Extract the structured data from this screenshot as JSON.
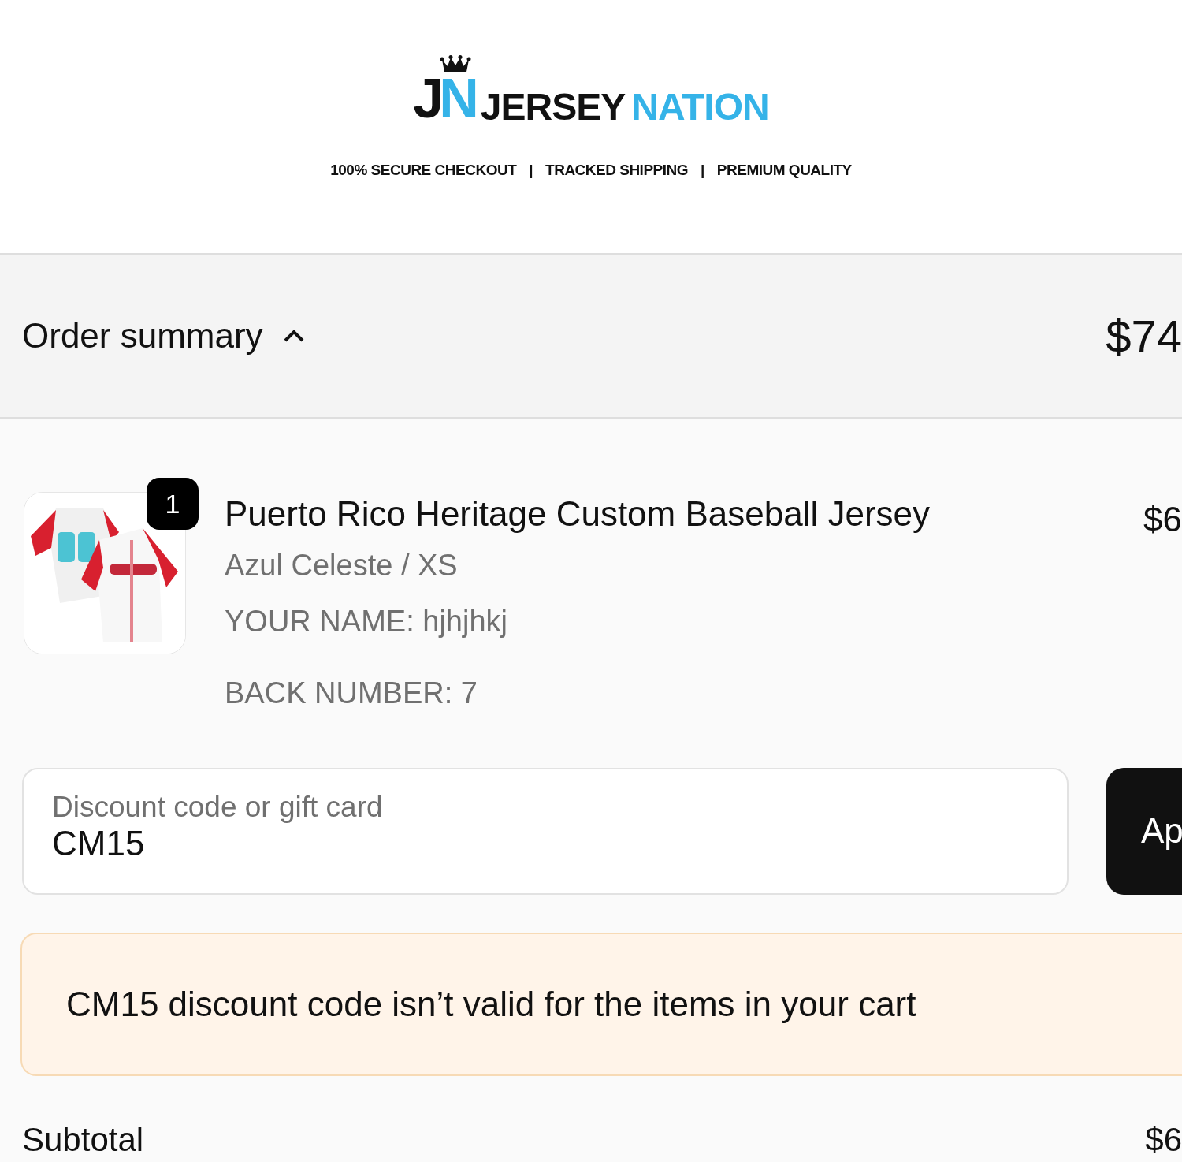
{
  "logo": {
    "monogram": [
      {
        "letter": "J",
        "color": "#111111"
      },
      {
        "letter": "N",
        "color": "#35b3e8"
      }
    ],
    "words": [
      {
        "text": "JERSEY",
        "color": "#111111"
      },
      {
        "text": "NATION",
        "color": "#35b3e8"
      }
    ]
  },
  "taglines": [
    "100% SECURE CHECKOUT",
    "TRACKED SHIPPING",
    "PREMIUM QUALITY"
  ],
  "tagline_separator": "|",
  "order_summary": {
    "label": "Order summary",
    "expanded": true,
    "total": "$74"
  },
  "items": [
    {
      "quantity": "1",
      "title": "Puerto Rico Heritage Custom Baseball Jersey",
      "variant": "Azul Celeste / XS",
      "properties": [
        "YOUR NAME: hjhjhkj",
        "BACK NUMBER: 7"
      ],
      "price": "$6"
    }
  ],
  "discount": {
    "placeholder": "Discount code or gift card",
    "value": "CM15",
    "button": "Ap"
  },
  "alert": {
    "message": "CM15 discount code isn’t valid for the items in your cart"
  },
  "totals": [
    {
      "label": "Subtotal",
      "value": "$6"
    }
  ]
}
